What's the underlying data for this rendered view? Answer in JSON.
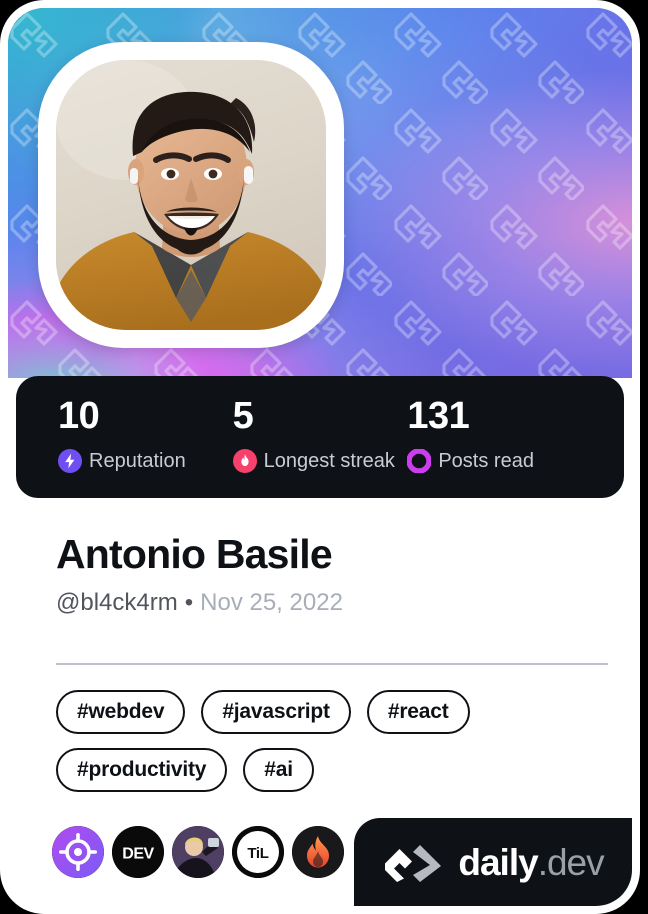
{
  "card": {
    "cover": {
      "pattern_icon": "daily-dev-logo-watermark",
      "gradient_colors": [
        "#3fb3cd",
        "#4a90e2",
        "#6a72e8",
        "#8f6fe0",
        "#e855f0"
      ]
    },
    "avatar": {
      "alt": "Antonio Basile profile photo",
      "border_color": "#ffffff"
    },
    "stats": {
      "background": "#0e1217",
      "items": [
        {
          "value": "10",
          "label": "Reputation",
          "icon": "reputation-bolt-icon",
          "color": "#6f4ff2"
        },
        {
          "value": "5",
          "label": "Longest streak",
          "icon": "streak-flame-icon",
          "color": "#f5416c"
        },
        {
          "value": "131",
          "label": "Posts read",
          "icon": "posts-read-ring-icon",
          "color": "#cd3df0"
        }
      ]
    },
    "identity": {
      "name": "Antonio Basile",
      "handle": "@bl4ck4rm",
      "separator": "•",
      "joined": "Nov 25, 2022"
    },
    "tags": [
      "#webdev",
      "#javascript",
      "#react",
      "#productivity",
      "#ai"
    ],
    "badges": [
      {
        "name": "target-source-badge",
        "label": ""
      },
      {
        "name": "dev-to-source-badge",
        "label": "DEV"
      },
      {
        "name": "avatar-source-badge",
        "label": ""
      },
      {
        "name": "til-source-badge",
        "label": "TiL"
      },
      {
        "name": "flame-source-badge",
        "label": ""
      }
    ],
    "brand": {
      "name": "daily",
      "tld": ".dev",
      "mark": "daily-dev-logo-icon"
    }
  }
}
